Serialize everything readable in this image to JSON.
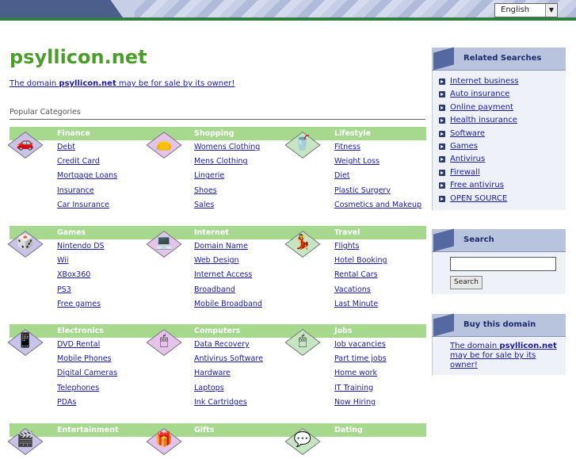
{
  "header": {
    "language": {
      "selected": "English"
    }
  },
  "main": {
    "domain": "psyllicon.net",
    "sale_note": {
      "prefix": "The domain ",
      "domain": "psyllicon.net",
      "suffix": " may be for sale by its owner!"
    },
    "popular_label": "Popular Categories"
  },
  "categories": [
    {
      "title": "Finance",
      "icon": "car-icon",
      "links": [
        "Debt",
        "Credit Card",
        "Mortgage Loans",
        "Insurance",
        "Car Insurance"
      ]
    },
    {
      "title": "Shopping",
      "icon": "shopping-icon",
      "links": [
        "Womens Clothing",
        "Mens Clothing",
        "Lingerie",
        "Shoes",
        "Sales"
      ]
    },
    {
      "title": "Lifestyle",
      "icon": "blender-icon",
      "links": [
        "Fitness",
        "Weight Loss",
        "Diet",
        "Plastic Surgery",
        "Cosmetics and Makeup"
      ]
    },
    {
      "title": "Games",
      "icon": "dice-icon",
      "links": [
        "Nintendo DS",
        "Wii",
        "XBox360",
        "PS3",
        "Free games"
      ]
    },
    {
      "title": "Internet",
      "icon": "computer-icon",
      "links": [
        "Domain Name",
        "Web Design",
        "Internet Access",
        "Broadband",
        "Mobile Broadband"
      ]
    },
    {
      "title": "Travel",
      "icon": "dancer-icon",
      "links": [
        "Flights",
        "Hotel Booking",
        "Rental Cars",
        "Vacations",
        "Last Minute"
      ]
    },
    {
      "title": "Electronics",
      "icon": "pda-icon",
      "links": [
        "DVD Rental",
        "Mobile Phones",
        "Digital Cameras",
        "Telephones",
        "PDAs"
      ]
    },
    {
      "title": "Computers",
      "icon": "mouse-icon",
      "links": [
        "Data Recovery",
        "Antivirus Software",
        "Hardware",
        "Laptops",
        "Ink Cartridges"
      ]
    },
    {
      "title": "Jobs",
      "icon": "mouse-icon",
      "links": [
        "Job vacancies",
        "Part time jobs",
        "Home work",
        "IT Training",
        "Now Hiring"
      ]
    },
    {
      "title": "Entertainment",
      "icon": "entertainment-icon",
      "links": []
    },
    {
      "title": "Gifts",
      "icon": "gift-icon",
      "links": []
    },
    {
      "title": "Dating",
      "icon": "dating-icon",
      "links": []
    }
  ],
  "sidebar": {
    "related": {
      "title": "Related Searches",
      "items": [
        "Internet business",
        "Auto insurance",
        "Online payment",
        "Health insurance",
        "Software",
        "Games",
        "Antivirus",
        "Firewall",
        "Free antivirus",
        "OPEN SOURCE"
      ]
    },
    "search": {
      "title": "Search",
      "button_label": "Search",
      "input_value": ""
    },
    "buy": {
      "title": "Buy this domain",
      "text_prefix": "The domain ",
      "text_domain": "psyllicon.net",
      "text_suffix": " may be for sale by its owner!"
    }
  },
  "colors": {
    "title_green": "#4b9d2a",
    "section_green": "#a6d98e",
    "link_blue": "#1a1aa8",
    "sidebar_head": "#b8c3dd"
  }
}
